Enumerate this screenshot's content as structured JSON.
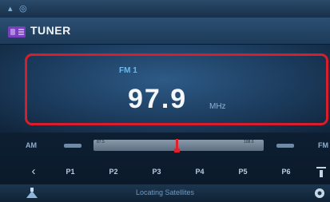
{
  "app": {
    "title": "TUNER"
  },
  "display": {
    "band": "FM 1",
    "frequency": "97.9",
    "unit": "MHz"
  },
  "tuning": {
    "am_label": "AM",
    "fm_label": "FM",
    "bar_min": "87.5",
    "bar_max": "108.0",
    "position_fraction": 0.49
  },
  "presets": [
    "P1",
    "P2",
    "P3",
    "P4",
    "P5",
    "P6"
  ],
  "status": {
    "text": "Locating Satellites"
  },
  "icons": {
    "status_1": "signal-icon",
    "status_2": "gps-icon",
    "back": "chevron-left-icon",
    "seek_down": "seek-down-icon",
    "seek_up": "seek-up-icon",
    "list": "list-icon",
    "source": "source-icon",
    "settings": "settings-icon"
  },
  "colors": {
    "highlight": "#d81e2a",
    "band_text": "#6fb8ec",
    "indicator": "#e0222e"
  }
}
